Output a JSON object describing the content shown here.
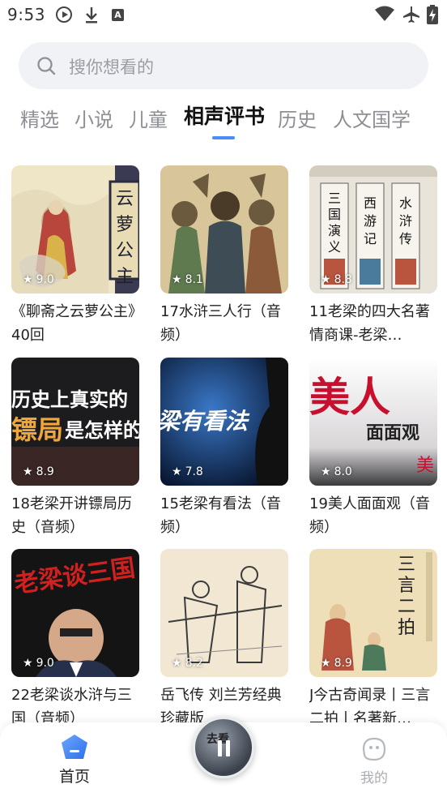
{
  "status_bar": {
    "time": "9:53"
  },
  "search": {
    "placeholder": "搜你想看的"
  },
  "tabs": [
    {
      "label": "精选",
      "active": false
    },
    {
      "label": "小说",
      "active": false
    },
    {
      "label": "儿童",
      "active": false
    },
    {
      "label": "相声评书",
      "active": true
    },
    {
      "label": "历史",
      "active": false
    },
    {
      "label": "人文国学",
      "active": false
    }
  ],
  "cards": [
    {
      "rating": "9.0",
      "title": "《聊斋之云萝公主》40回",
      "cover_text": "云萝公主",
      "cover_theme": "paper"
    },
    {
      "rating": "8.1",
      "title": "17水浒三人行（音频）",
      "cover_text": "",
      "cover_theme": "sketch"
    },
    {
      "rating": "8.8",
      "title": "11老梁的四大名著情商课-老梁…",
      "cover_text": "三国演义 西游记 水浒传",
      "cover_theme": "books"
    },
    {
      "rating": "8.9",
      "title": "18老梁开讲镖局历史（音频）",
      "cover_text": "历史上真实的镖局是怎样的",
      "cover_theme": "dark-red"
    },
    {
      "rating": "7.8",
      "title": "15老梁有看法（音频）",
      "cover_text": "梁有看法",
      "cover_theme": "blue-stage"
    },
    {
      "rating": "8.0",
      "title": "19美人面面观（音频）",
      "cover_text": "美人 面面观",
      "cover_theme": "pink"
    },
    {
      "rating": "9.0",
      "title": "22老梁谈水浒与三国（音频）",
      "cover_text": "老梁谈三国",
      "cover_theme": "red-portrait"
    },
    {
      "rating": "8.2",
      "title": "岳飞传 刘兰芳经典珍藏版",
      "cover_text": "",
      "cover_theme": "sketch-light"
    },
    {
      "rating": "8.9",
      "title": "J今古奇闻录丨三言二拍丨名著新…",
      "cover_text": "三言二拍",
      "cover_theme": "yellow-paper"
    }
  ],
  "bottom_nav": {
    "home_label": "首页",
    "mine_label": "我的",
    "player_cover_text": "去看"
  },
  "colors": {
    "accent": "#4a8df8",
    "tab_inactive": "#8e8f94"
  }
}
